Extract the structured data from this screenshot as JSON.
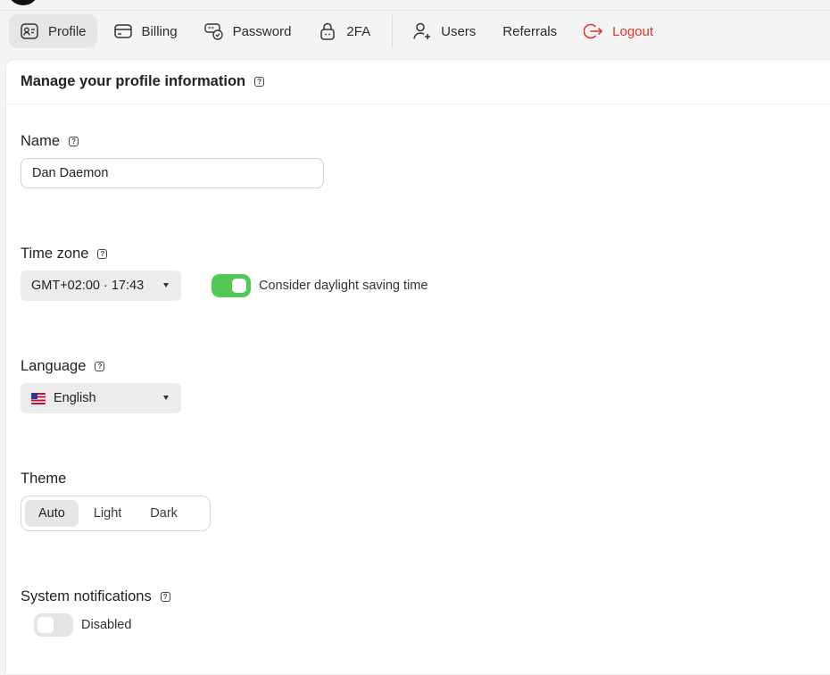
{
  "tabs": [
    {
      "key": "profile",
      "label": "Profile",
      "icon": "profile-card-icon",
      "active": true
    },
    {
      "key": "billing",
      "label": "Billing",
      "icon": "credit-card-icon",
      "active": false
    },
    {
      "key": "password",
      "label": "Password",
      "icon": "password-shield-icon",
      "active": false
    },
    {
      "key": "2fa",
      "label": "2FA",
      "icon": "lock-icon",
      "active": false
    },
    {
      "key": "users",
      "label": "Users",
      "icon": "add-user-icon",
      "active": false
    },
    {
      "key": "referrals",
      "label": "Referrals",
      "icon": "",
      "active": false
    },
    {
      "key": "logout",
      "label": "Logout",
      "icon": "logout-icon",
      "active": false
    }
  ],
  "header": {
    "title": "Manage your profile information"
  },
  "name": {
    "label": "Name",
    "value": "Dan Daemon"
  },
  "timezone": {
    "label": "Time zone",
    "selected": "GMT+02:00 · 17:43",
    "dst_label": "Consider daylight saving time",
    "dst_enabled": true
  },
  "language": {
    "label": "Language",
    "selected": "English",
    "flag_icon": "us-flag-icon"
  },
  "theme": {
    "label": "Theme",
    "options": [
      "Auto",
      "Light",
      "Dark"
    ],
    "selected": "Auto"
  },
  "notifications": {
    "label": "System notifications",
    "status": "Disabled",
    "enabled": false
  },
  "colors": {
    "accent_green": "#52c752",
    "logout_red": "#e5322d"
  }
}
